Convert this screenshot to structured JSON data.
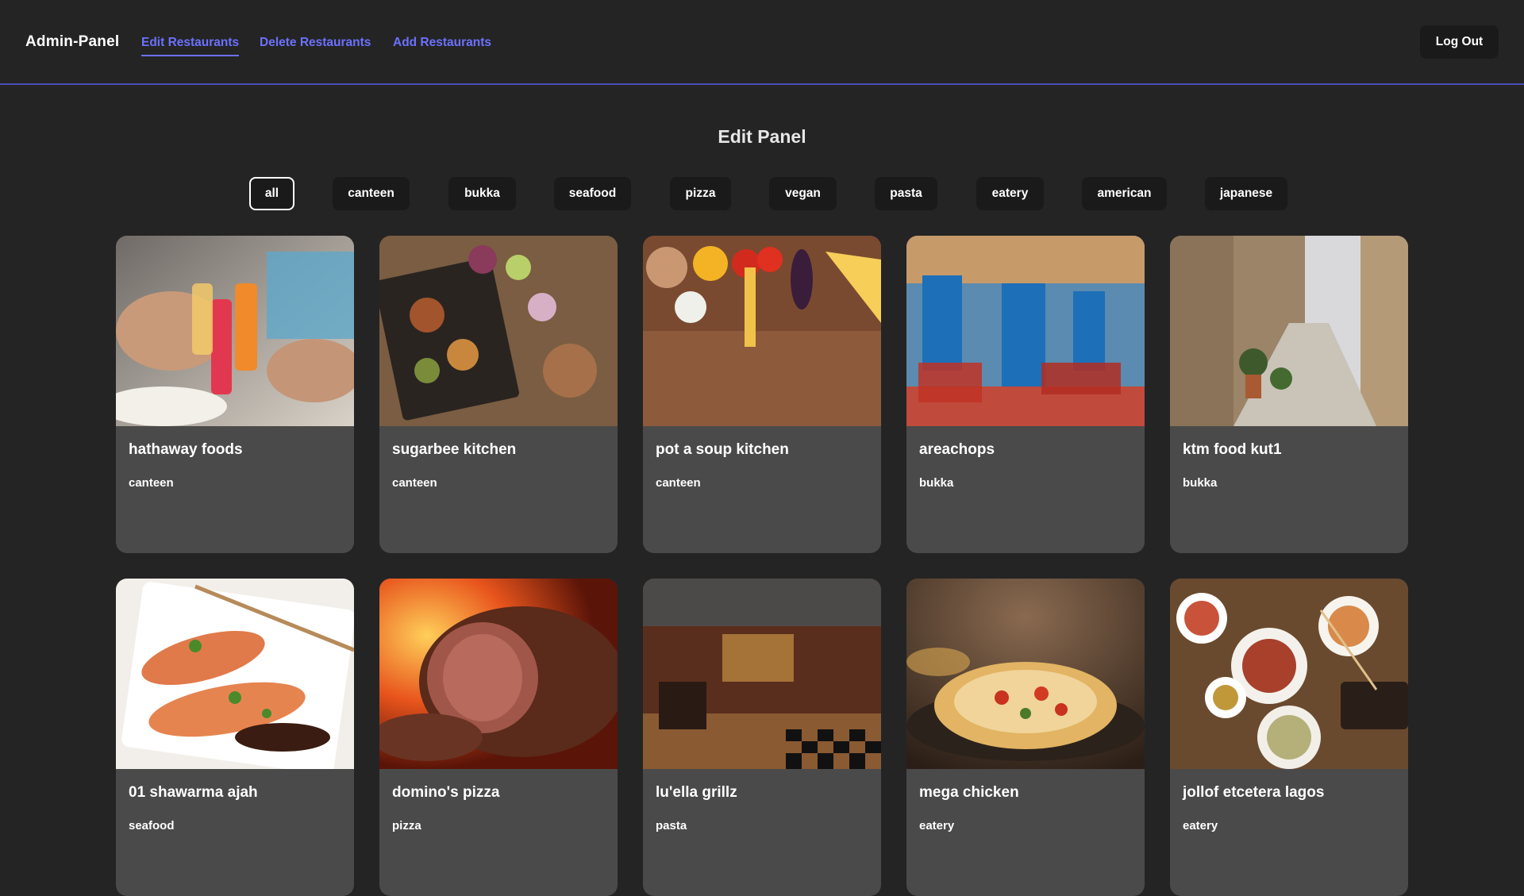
{
  "header": {
    "brand": "Admin-Panel",
    "nav": [
      {
        "label": "Edit Restaurants",
        "active": true
      },
      {
        "label": "Delete Restaurants",
        "active": false
      },
      {
        "label": "Add Restaurants",
        "active": false
      }
    ],
    "logout_label": "Log Out"
  },
  "main": {
    "title": "Edit Panel",
    "filters": [
      {
        "label": "all",
        "active": true
      },
      {
        "label": "canteen"
      },
      {
        "label": "bukka"
      },
      {
        "label": "seafood"
      },
      {
        "label": "pizza"
      },
      {
        "label": "vegan"
      },
      {
        "label": "pasta"
      },
      {
        "label": "eatery"
      },
      {
        "label": "american"
      },
      {
        "label": "japanese"
      }
    ],
    "restaurants": [
      {
        "name": "hathaway foods",
        "category": "canteen",
        "image": "friends-toasting-cocktails-photo"
      },
      {
        "name": "sugarbee kitchen",
        "category": "canteen",
        "image": "grilled-food-on-wooden-table-photo"
      },
      {
        "name": "pot a soup kitchen",
        "category": "canteen",
        "image": "vegetables-and-pasta-on-wood-photo"
      },
      {
        "name": "areachops",
        "category": "bukka",
        "image": "street-cafe-blue-doors-photo"
      },
      {
        "name": "ktm food kut1",
        "category": "bukka",
        "image": "old-stone-alley-photo"
      },
      {
        "name": "01 shawarma ajah",
        "category": "seafood",
        "image": "salmon-with-herbs-photo"
      },
      {
        "name": "domino's pizza",
        "category": "pizza",
        "image": "roast-beef-by-fire-photo"
      },
      {
        "name": "lu'ella grillz",
        "category": "pasta",
        "image": "restaurant-interior-checkered-floor-photo"
      },
      {
        "name": "mega chicken",
        "category": "eatery",
        "image": "rustic-pizza-on-board-photo"
      },
      {
        "name": "jollof etcetera lagos",
        "category": "eatery",
        "image": "table-with-dishes-and-chopsticks-photo"
      }
    ]
  },
  "colors": {
    "background": "#242424",
    "card": "#4a4a4a",
    "link": "#6c71ff",
    "header_border": "#4b4fb8",
    "button": "#1a1a1a"
  }
}
